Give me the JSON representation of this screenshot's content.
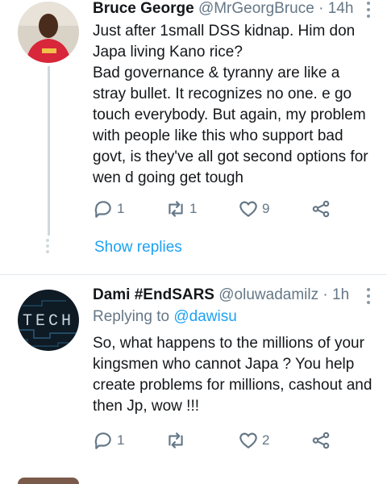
{
  "tweets": [
    {
      "name": "Bruce George",
      "handle": "@MrGeorgBruce",
      "separator": "·",
      "time": "14h",
      "lines": [
        "Just after 1small DSS kidnap. Him don Japa living Kano rice?",
        "Bad governance & tyranny are like a stray bullet. It recognizes no one. e go touch everybody. But again, my problem with people like this who support bad govt, is they've all got second options for wen d going get tough"
      ],
      "reply_count": "1",
      "retweet_count": "1",
      "like_count": "9",
      "show_replies": "Show replies"
    },
    {
      "name": "Dami #EndSARS",
      "handle": "@oluwadamilz",
      "separator": "·",
      "time": "1h",
      "replying_to_label": "Replying to",
      "replying_to_handle": "@dawisu",
      "lines": [
        "So, what happens to the millions of your kingsmen who cannot Japa ?  You help create problems for millions, cashout and then Jp, wow !!!"
      ],
      "reply_count": "1",
      "retweet_count": "",
      "like_count": "2"
    }
  ],
  "icons": {
    "reply": "reply-icon",
    "retweet": "retweet-icon",
    "like": "heart-icon",
    "share": "share-icon",
    "more": "more-vertical-icon"
  },
  "colors": {
    "link": "#1da1f2",
    "muted": "#657786",
    "thread_line": "#cfd9de"
  }
}
